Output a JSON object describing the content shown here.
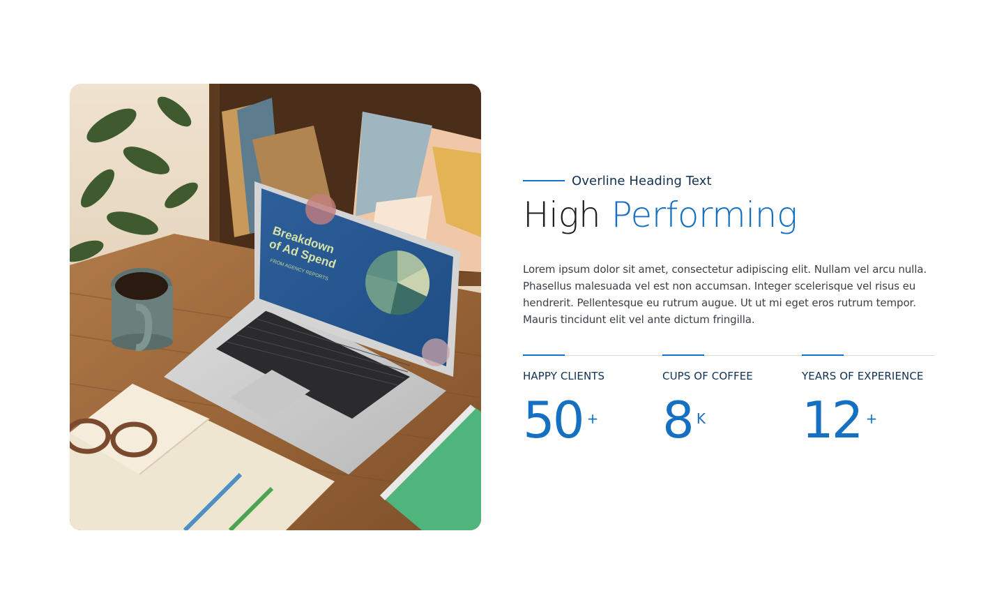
{
  "image": {
    "subject": "Workspace photo"
  },
  "overline": {
    "text": "Overline Heading Text"
  },
  "heading": {
    "prefix": "High",
    "accent": "Performing"
  },
  "body": {
    "text": "Lorem ipsum dolor sit amet, consectetur adipiscing elit. Nullam vel arcu nulla. Phasellus malesuada vel est non accumsan. Integer scelerisque vel risus eu hendrerit. Pellentesque eu rutrum augue. Ut ut mi eget eros rutrum tempor. Mauris tincidunt elit vel ante dictum fringilla."
  },
  "stats": [
    {
      "label": "HAPPY CLIENTS",
      "value": "50",
      "suffix": "+"
    },
    {
      "label": "CUPS OF COFFEE",
      "value": "8",
      "suffix": "K"
    },
    {
      "label": "YEARS OF EXPERIENCE",
      "value": "12",
      "suffix": "+"
    }
  ],
  "colors": {
    "accent": "#1570c2",
    "heading": "#1d1d23",
    "overline": "#12304e",
    "body": "#3a3f47",
    "divider": "#d7d9dd"
  },
  "photo_screen": {
    "title_line1": "Breakdown",
    "title_line2": "of Ad Spend",
    "subtitle": "FROM AGENCY REPORTS"
  }
}
